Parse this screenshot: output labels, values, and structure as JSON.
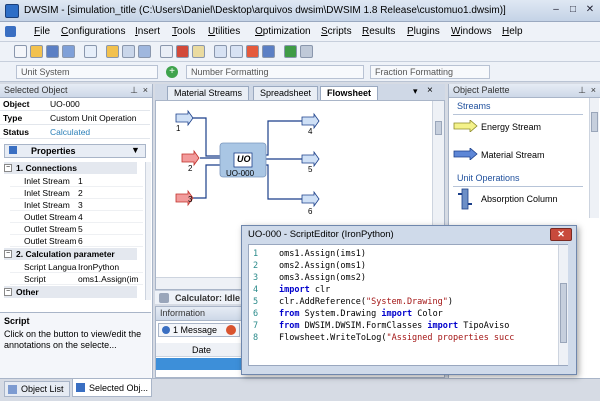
{
  "window": {
    "title": "DWSIM - [simulation_title (C:\\Users\\Daniel\\Desktop\\arquivos dwsim\\DWSIM 1.8 Release\\customuo1.dwsim)]",
    "controls": [
      "–",
      "□",
      "✕"
    ]
  },
  "menu": [
    "File",
    "Configurations",
    "Insert",
    "Tools",
    "Utilities",
    "Optimization",
    "Scripts",
    "Results",
    "Plugins",
    "Windows",
    "Help"
  ],
  "toolbar2": {
    "unit_system": "Unit System",
    "number_formatting": "Number Formatting",
    "fraction_formatting": "Fraction Formatting"
  },
  "left_panel": {
    "header": "Selected Object",
    "object_label": "Object",
    "object_value": "UO-000",
    "type_label": "Type",
    "type_value": "Custom Unit Operation",
    "status_label": "Status",
    "status_value": "Calculated",
    "properties_tab": "Properties",
    "cat1": "1. Connections",
    "connections": [
      {
        "k": "Inlet Stream",
        "v": "1"
      },
      {
        "k": "Inlet Stream",
        "v": "2"
      },
      {
        "k": "Inlet Stream",
        "v": "3"
      },
      {
        "k": "Outlet Stream",
        "v": "4"
      },
      {
        "k": "Outlet Stream",
        "v": "5"
      },
      {
        "k": "Outlet Stream",
        "v": "6"
      }
    ],
    "cat2": "2. Calculation parameter",
    "calc": [
      {
        "k": "Script Langua",
        "v": "IronPython"
      },
      {
        "k": "Script",
        "v": "oms1.Assign(im"
      }
    ],
    "cat3": "Other",
    "help_title": "Script",
    "help_text": "Click on the button to view/edit the annotations on the selecte..."
  },
  "doc_tabs": [
    "Material Streams",
    "Spreadsheet",
    "Flowsheet"
  ],
  "flowsheet": {
    "block_label": "UO",
    "block_name": "UO-000",
    "inlets": [
      "1",
      "2",
      "3"
    ],
    "outlets": [
      "4",
      "5",
      "6"
    ]
  },
  "calculator_status": "Calculator: Idle",
  "info_panel": {
    "header": "Information",
    "tab_message": "1 Message",
    "col_date": "Date"
  },
  "palette": {
    "header": "Object Palette",
    "section_streams": "Streams",
    "energy_stream": "Energy Stream",
    "material_stream": "Material Stream",
    "section_unitops": "Unit Operations",
    "absorption_column": "Absorption Column"
  },
  "bottom_tabs": [
    "Object List",
    "Selected Obj..."
  ],
  "editor": {
    "title": "UO-000 - ScriptEditor (IronPython)",
    "lines": [
      {
        "n": "1",
        "parts": [
          {
            "t": "oms1.Assign(ims1)",
            "c": ""
          }
        ]
      },
      {
        "n": "2",
        "parts": [
          {
            "t": "oms2.Assign(oms1)",
            "c": ""
          }
        ]
      },
      {
        "n": "3",
        "parts": [
          {
            "t": "oms3.Assign(oms2)",
            "c": ""
          }
        ]
      },
      {
        "n": "4",
        "parts": [
          {
            "t": "import",
            "c": "kw"
          },
          {
            "t": " clr",
            "c": ""
          }
        ]
      },
      {
        "n": "5",
        "parts": [
          {
            "t": "clr.AddReference(",
            "c": ""
          },
          {
            "t": "\"System.Drawing\"",
            "c": "str"
          },
          {
            "t": ")",
            "c": ""
          }
        ]
      },
      {
        "n": "6",
        "parts": [
          {
            "t": "from",
            "c": "kw"
          },
          {
            "t": " System.Drawing ",
            "c": ""
          },
          {
            "t": "import",
            "c": "kw"
          },
          {
            "t": " Color",
            "c": ""
          }
        ]
      },
      {
        "n": "7",
        "parts": [
          {
            "t": "from",
            "c": "kw"
          },
          {
            "t": " DWSIM.DWSIM.FormClasses ",
            "c": ""
          },
          {
            "t": "import",
            "c": "kw"
          },
          {
            "t": " TipoAviso",
            "c": ""
          }
        ]
      },
      {
        "n": "8",
        "parts": [
          {
            "t": "Flowsheet.WriteToLog(",
            "c": ""
          },
          {
            "t": "\"Assigned properties succ",
            "c": "str"
          }
        ]
      }
    ]
  }
}
